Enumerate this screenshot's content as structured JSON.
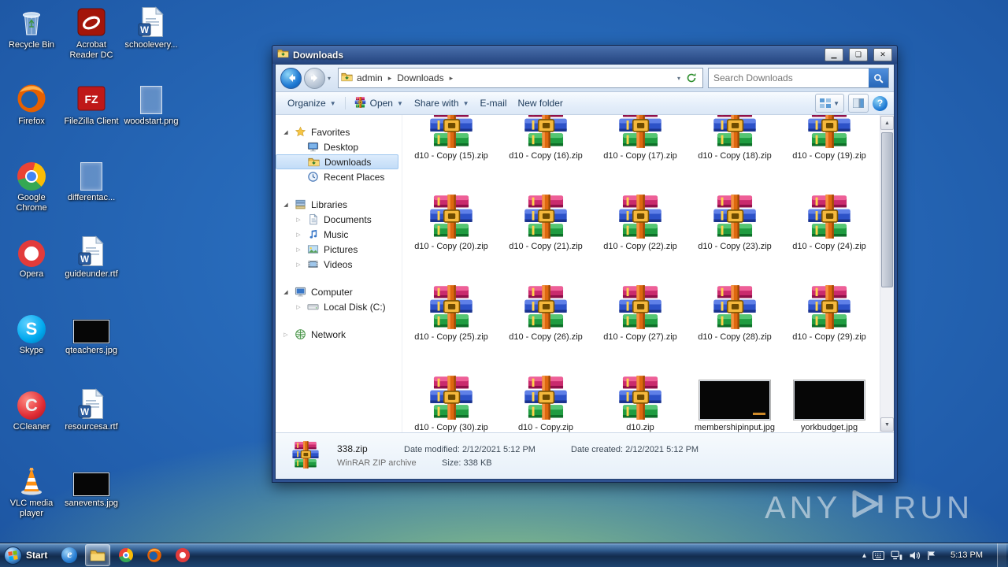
{
  "desktop": {
    "icons": [
      {
        "label": "Recycle Bin",
        "type": "recycle-bin"
      },
      {
        "label": "Firefox",
        "type": "firefox"
      },
      {
        "label": "Google Chrome",
        "type": "chrome"
      },
      {
        "label": "Opera",
        "type": "opera"
      },
      {
        "label": "Skype",
        "type": "skype"
      },
      {
        "label": "CCleaner",
        "type": "ccleaner"
      },
      {
        "label": "VLC media player",
        "type": "vlc"
      },
      {
        "label": "Acrobat Reader DC",
        "type": "acrobat"
      },
      {
        "label": "FileZilla Client",
        "type": "filezilla"
      },
      {
        "label": "differentac...",
        "type": "ghost-doc"
      },
      {
        "label": "guideunder.rtf",
        "type": "word-doc"
      },
      {
        "label": "qteachers.jpg",
        "type": "jpg-thumb"
      },
      {
        "label": "resourcesa.rtf",
        "type": "word-doc"
      },
      {
        "label": "sanevents.jpg",
        "type": "jpg-thumb"
      },
      {
        "label": "schoolevery...",
        "type": "word-doc"
      },
      {
        "label": "woodstart.png",
        "type": "ghost-doc"
      }
    ],
    "watermark": {
      "left": "ANY",
      "right": "RUN"
    }
  },
  "explorer": {
    "title": "Downloads",
    "address": {
      "user": "admin",
      "folder": "Downloads"
    },
    "search": {
      "placeholder": "Search Downloads"
    },
    "toolbar": {
      "organize": "Organize",
      "open": "Open",
      "share": "Share with",
      "email": "E-mail",
      "new_folder": "New folder"
    },
    "sidebar": {
      "sections": [
        {
          "label": "Favorites",
          "type": "favorites",
          "expanded": true,
          "items": [
            {
              "label": "Desktop",
              "type": "desktop"
            },
            {
              "label": "Downloads",
              "type": "downloads",
              "selected": true
            },
            {
              "label": "Recent Places",
              "type": "recent-places"
            }
          ]
        },
        {
          "label": "Libraries",
          "type": "libraries",
          "expanded": true,
          "items": [
            {
              "label": "Documents",
              "type": "documents",
              "expandable": true
            },
            {
              "label": "Music",
              "type": "music",
              "expandable": true
            },
            {
              "label": "Pictures",
              "type": "pictures",
              "expandable": true
            },
            {
              "label": "Videos",
              "type": "videos",
              "expandable": true
            }
          ]
        },
        {
          "label": "Computer",
          "type": "computer",
          "expanded": true,
          "items": [
            {
              "label": "Local Disk (C:)",
              "type": "local-disk",
              "expandable": true
            }
          ]
        },
        {
          "label": "Network",
          "type": "network",
          "expanded": false,
          "items": []
        }
      ]
    },
    "files": [
      {
        "label": "d10 - Copy (15).zip",
        "type": "winrar"
      },
      {
        "label": "d10 - Copy (16).zip",
        "type": "winrar"
      },
      {
        "label": "d10 - Copy (17).zip",
        "type": "winrar"
      },
      {
        "label": "d10 - Copy (18).zip",
        "type": "winrar"
      },
      {
        "label": "d10 - Copy (19).zip",
        "type": "winrar"
      },
      {
        "label": "d10 - Copy (20).zip",
        "type": "winrar"
      },
      {
        "label": "d10 - Copy (21).zip",
        "type": "winrar"
      },
      {
        "label": "d10 - Copy (22).zip",
        "type": "winrar"
      },
      {
        "label": "d10 - Copy (23).zip",
        "type": "winrar"
      },
      {
        "label": "d10 - Copy (24).zip",
        "type": "winrar"
      },
      {
        "label": "d10 - Copy (25).zip",
        "type": "winrar"
      },
      {
        "label": "d10 - Copy (26).zip",
        "type": "winrar"
      },
      {
        "label": "d10 - Copy (27).zip",
        "type": "winrar"
      },
      {
        "label": "d10 - Copy (28).zip",
        "type": "winrar"
      },
      {
        "label": "d10 - Copy (29).zip",
        "type": "winrar"
      },
      {
        "label": "d10 - Copy (30).zip",
        "type": "winrar"
      },
      {
        "label": "d10 - Copy.zip",
        "type": "winrar"
      },
      {
        "label": "d10.zip",
        "type": "winrar"
      },
      {
        "label": "membershipinput.jpg",
        "type": "jpg-thumb",
        "mark": true
      },
      {
        "label": "yorkbudget.jpg",
        "type": "jpg-thumb"
      }
    ],
    "details": {
      "name": "338.zip",
      "type": "WinRAR ZIP archive",
      "modified_label": "Date modified:",
      "modified_value": "2/12/2021 5:12 PM",
      "size_label": "Size:",
      "size_value": "338 KB",
      "created_label": "Date created:",
      "created_value": "2/12/2021 5:12 PM"
    }
  },
  "taskbar": {
    "start_label": "Start",
    "pinned": [
      {
        "name": "internet-explorer"
      },
      {
        "name": "windows-explorer",
        "active": true
      },
      {
        "name": "google-chrome"
      },
      {
        "name": "firefox"
      },
      {
        "name": "opera"
      }
    ],
    "tray": [
      {
        "name": "hidden-icons"
      },
      {
        "name": "keyboard"
      },
      {
        "name": "network"
      },
      {
        "name": "volume"
      },
      {
        "name": "action-center"
      }
    ],
    "time": "5:13 PM"
  }
}
